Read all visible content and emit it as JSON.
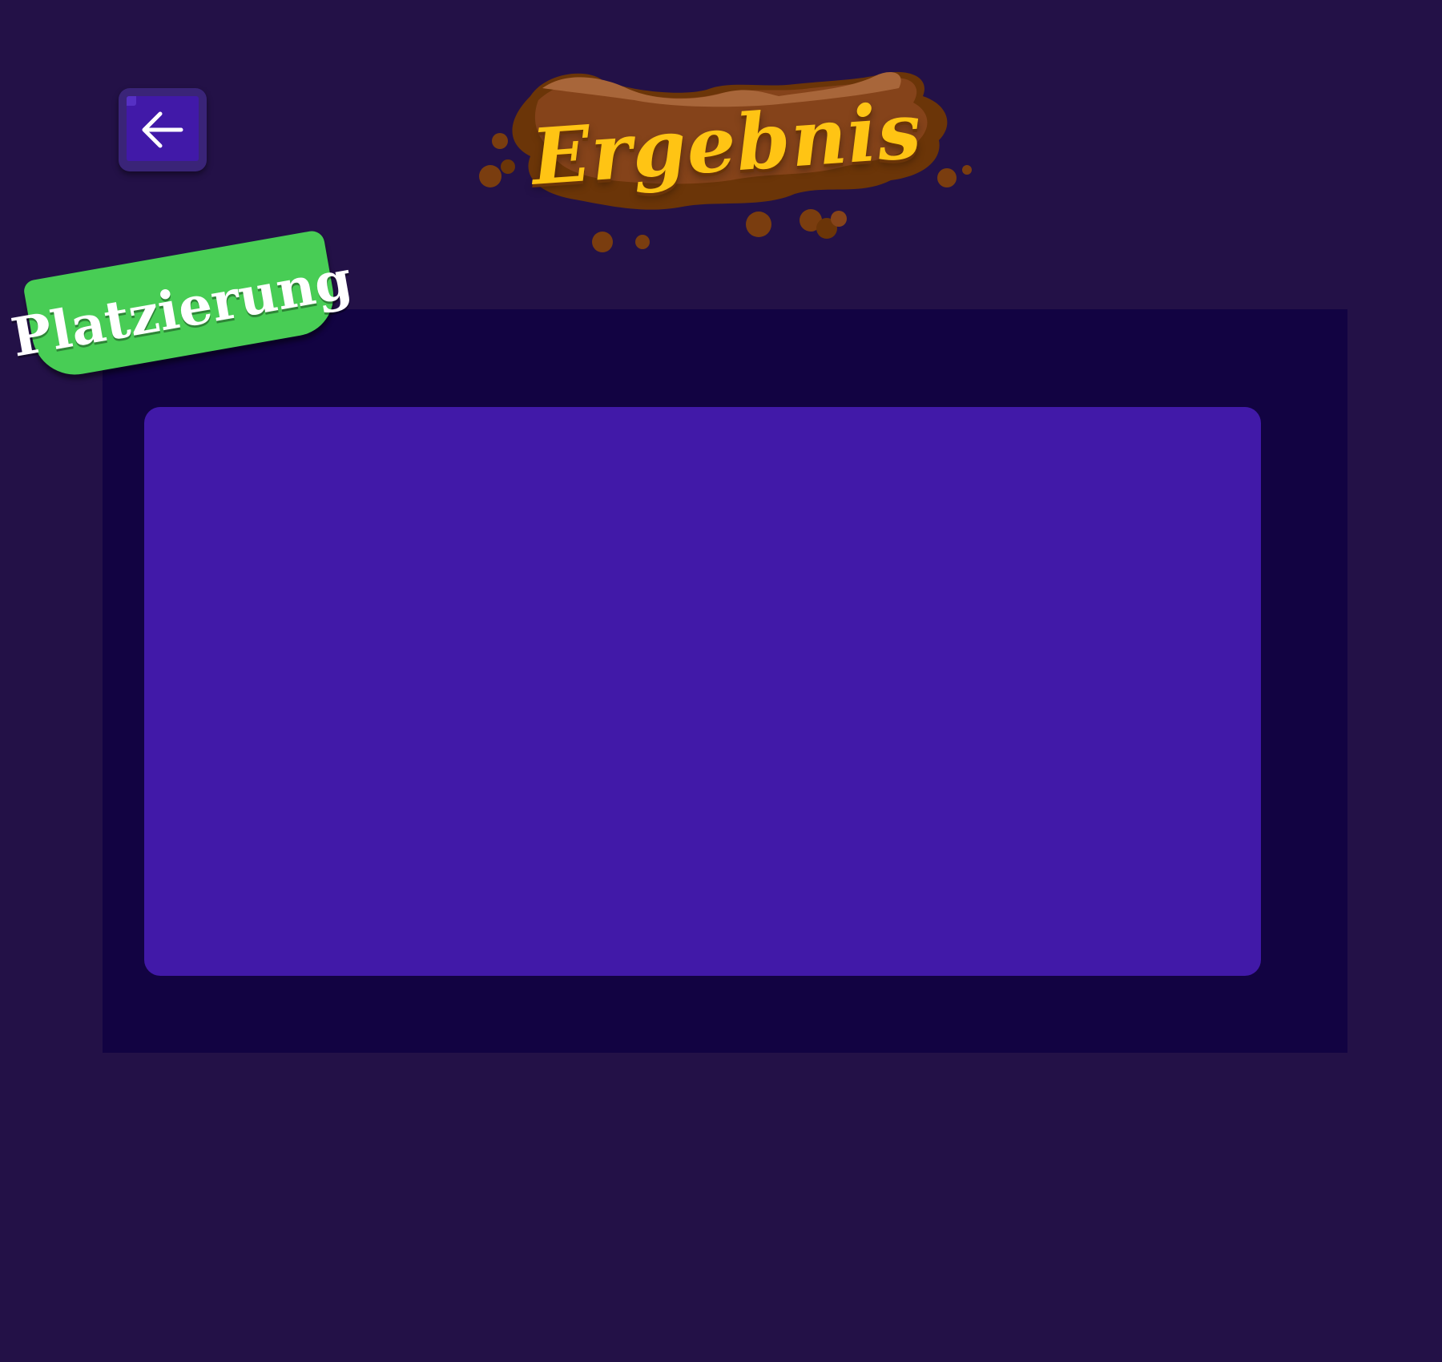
{
  "header": {
    "title": "Ergebnis",
    "back_button": {
      "icon": "arrow-left-icon"
    }
  },
  "placement": {
    "label": "Platzierung"
  },
  "colors": {
    "background": "#231147",
    "panel": "#120342",
    "panel_inner": "#4119a8",
    "tag": "#48cd55",
    "title": "#ffc414",
    "splash": "#7a3d0f"
  }
}
